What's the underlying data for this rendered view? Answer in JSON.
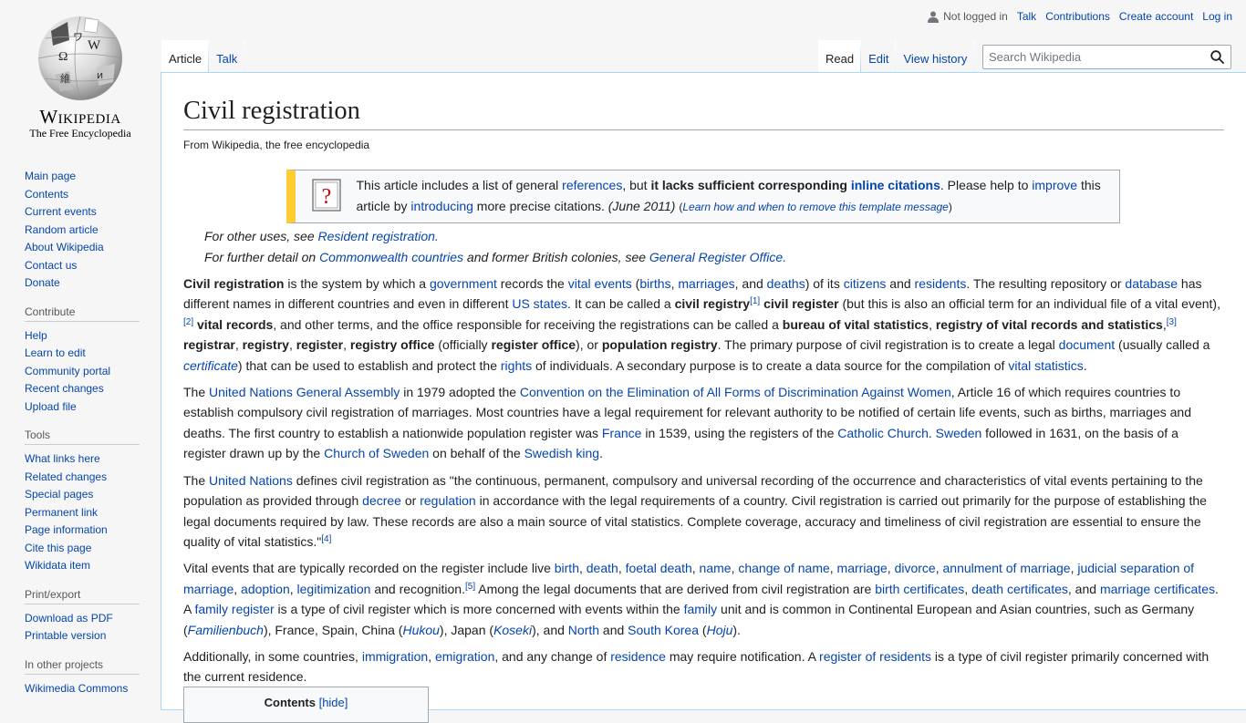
{
  "logo": {
    "wordmark": "Wikipedia",
    "tagline": "The Free Encyclopedia"
  },
  "sidebar": {
    "nav": [
      "Main page",
      "Contents",
      "Current events",
      "Random article",
      "About Wikipedia",
      "Contact us",
      "Donate"
    ],
    "contribute": {
      "heading": "Contribute",
      "items": [
        "Help",
        "Learn to edit",
        "Community portal",
        "Recent changes",
        "Upload file"
      ]
    },
    "tools": {
      "heading": "Tools",
      "items": [
        "What links here",
        "Related changes",
        "Special pages",
        "Permanent link",
        "Page information",
        "Cite this page",
        "Wikidata item"
      ]
    },
    "print": {
      "heading": "Print/export",
      "items": [
        "Download as PDF",
        "Printable version"
      ]
    },
    "projects": {
      "heading": "In other projects",
      "items": [
        "Wikimedia Commons"
      ]
    }
  },
  "personal": {
    "not_logged": "Not logged in",
    "talk": "Talk",
    "contributions": "Contributions",
    "create_account": "Create account",
    "login": "Log in"
  },
  "tabs": {
    "article": "Article",
    "talk": "Talk",
    "read": "Read",
    "edit": "Edit",
    "history": "View history"
  },
  "search": {
    "placeholder": "Search Wikipedia"
  },
  "page": {
    "title": "Civil registration",
    "sitesub": "From Wikipedia, the free encyclopedia",
    "ambox": {
      "t1": "This article includes a list of general ",
      "l1": "references",
      "t2": ", but ",
      "b1": "it lacks sufficient corresponding ",
      "l2": "inline citations",
      "t3": ". Please help to ",
      "l3": "improve",
      "t4": " this article by ",
      "l4": "introducing",
      "t5": " more precise citations. ",
      "date": "(June 2011)",
      "l5": "Learn how and when to remove this template message"
    },
    "hat1": {
      "text": "For other uses, see ",
      "link": "Resident registration."
    },
    "hat2": {
      "text": "For further detail on ",
      "link1": "Commonwealth countries",
      "mid": " and former British colonies, see ",
      "link2": "General Register Office."
    },
    "p1": [
      [
        "b",
        "Civil registration"
      ],
      [
        "t",
        " is the system by which a "
      ],
      [
        "a",
        "government"
      ],
      [
        "t",
        " records the "
      ],
      [
        "a",
        "vital events"
      ],
      [
        "t",
        " ("
      ],
      [
        "a",
        "births"
      ],
      [
        "t",
        ", "
      ],
      [
        "a",
        "marriages"
      ],
      [
        "t",
        ", and "
      ],
      [
        "a",
        "deaths"
      ],
      [
        "t",
        ") of its "
      ],
      [
        "a",
        "citizens"
      ],
      [
        "t",
        " and "
      ],
      [
        "a",
        "residents"
      ],
      [
        "t",
        ". The resulting repository or "
      ],
      [
        "a",
        "database"
      ],
      [
        "t",
        " has different names in different countries and even in different "
      ],
      [
        "a",
        "US states"
      ],
      [
        "t",
        ". It can be called a "
      ],
      [
        "b",
        "civil registry"
      ],
      [
        "s",
        "[1]"
      ],
      [
        "t",
        " "
      ],
      [
        "b",
        "civil register"
      ],
      [
        "t",
        " (but this is also an official term for an individual file of a vital event),"
      ],
      [
        "s",
        "[2]"
      ],
      [
        "t",
        " "
      ],
      [
        "b",
        "vital records"
      ],
      [
        "t",
        ", and other terms, and the office responsible for receiving the registrations can be called a "
      ],
      [
        "b",
        "bureau of vital statistics"
      ],
      [
        "t",
        ", "
      ],
      [
        "b",
        "registry of vital records and statistics"
      ],
      [
        "t",
        ","
      ],
      [
        "s",
        "[3]"
      ],
      [
        "t",
        " "
      ],
      [
        "b",
        "registrar"
      ],
      [
        "t",
        ", "
      ],
      [
        "b",
        "registry"
      ],
      [
        "t",
        ", "
      ],
      [
        "b",
        "register"
      ],
      [
        "t",
        ", "
      ],
      [
        "b",
        "registry office"
      ],
      [
        "t",
        " (officially "
      ],
      [
        "b",
        "register office"
      ],
      [
        "t",
        "), or "
      ],
      [
        "b",
        "population registry"
      ],
      [
        "t",
        ". The primary purpose of civil registration is to create a legal "
      ],
      [
        "a",
        "document"
      ],
      [
        "t",
        " (usually called a "
      ],
      [
        "ai",
        "certificate"
      ],
      [
        "t",
        ") that can be used to establish and protect the "
      ],
      [
        "a",
        "rights"
      ],
      [
        "t",
        " of individuals. A secondary purpose is to create a data source for the compilation of "
      ],
      [
        "a",
        "vital statistics"
      ],
      [
        "t",
        "."
      ]
    ],
    "p2": [
      [
        "t",
        "The "
      ],
      [
        "a",
        "United Nations General Assembly"
      ],
      [
        "t",
        " in 1979 adopted the "
      ],
      [
        "a",
        "Convention on the Elimination of All Forms of Discrimination Against Women"
      ],
      [
        "t",
        ", Article 16 of which requires countries to establish compulsory civil registration of marriages. Most countries have a legal requirement for relevant authority to be notified of certain life events, such as births, marriages and deaths. The first country to establish a nationwide population register was "
      ],
      [
        "a",
        "France"
      ],
      [
        "t",
        " in 1539, using the registers of the "
      ],
      [
        "a",
        "Catholic Church"
      ],
      [
        "t",
        ". "
      ],
      [
        "a",
        "Sweden"
      ],
      [
        "t",
        " followed in 1631, on the basis of a register drawn up by the "
      ],
      [
        "a",
        "Church of Sweden"
      ],
      [
        "t",
        " on behalf of the "
      ],
      [
        "a",
        "Swedish king"
      ],
      [
        "t",
        "."
      ]
    ],
    "p3": [
      [
        "t",
        "The "
      ],
      [
        "a",
        "United Nations"
      ],
      [
        "t",
        " defines civil registration as \"the continuous, permanent, compulsory and universal recording of the occurrence and characteristics of vital events pertaining to the population as provided through "
      ],
      [
        "a",
        "decree"
      ],
      [
        "t",
        " or "
      ],
      [
        "a",
        "regulation"
      ],
      [
        "t",
        " in accordance with the legal requirements of a country. Civil registration is carried out primarily for the purpose of establishing the legal documents required by law. These records are also a main source of vital statistics. Complete coverage, accuracy and timeliness of civil registration are essential to ensure the quality of vital statistics.\""
      ],
      [
        "s",
        "[4]"
      ]
    ],
    "p4": [
      [
        "t",
        "Vital events that are typically recorded on the register include live "
      ],
      [
        "a",
        "birth"
      ],
      [
        "t",
        ", "
      ],
      [
        "a",
        "death"
      ],
      [
        "t",
        ", "
      ],
      [
        "a",
        "foetal death"
      ],
      [
        "t",
        ", "
      ],
      [
        "a",
        "name"
      ],
      [
        "t",
        ", "
      ],
      [
        "a",
        "change of name"
      ],
      [
        "t",
        ", "
      ],
      [
        "a",
        "marriage"
      ],
      [
        "t",
        ", "
      ],
      [
        "a",
        "divorce"
      ],
      [
        "t",
        ", "
      ],
      [
        "a",
        "annulment of marriage"
      ],
      [
        "t",
        ", "
      ],
      [
        "a",
        "judicial separation of marriage"
      ],
      [
        "t",
        ", "
      ],
      [
        "a",
        "adoption"
      ],
      [
        "t",
        ", "
      ],
      [
        "a",
        "legitimization"
      ],
      [
        "t",
        " and recognition."
      ],
      [
        "s",
        "[5]"
      ],
      [
        "t",
        " Among the legal documents that are derived from civil registration are "
      ],
      [
        "a",
        "birth certificates"
      ],
      [
        "t",
        ", "
      ],
      [
        "a",
        "death certificates"
      ],
      [
        "t",
        ", and "
      ],
      [
        "a",
        "marriage certificates"
      ],
      [
        "t",
        ". A "
      ],
      [
        "a",
        "family register"
      ],
      [
        "t",
        " is a type of civil register which is more concerned with events within the "
      ],
      [
        "a",
        "family"
      ],
      [
        "t",
        " unit and is common in Continental European and Asian countries, such as Germany ("
      ],
      [
        "ai",
        "Familienbuch"
      ],
      [
        "t",
        "), France, Spain, China ("
      ],
      [
        "ai",
        "Hukou"
      ],
      [
        "t",
        "), Japan ("
      ],
      [
        "ai",
        "Koseki"
      ],
      [
        "t",
        "), and "
      ],
      [
        "a",
        "North"
      ],
      [
        "t",
        " and "
      ],
      [
        "a",
        "South Korea"
      ],
      [
        "t",
        " ("
      ],
      [
        "ai",
        "Hoju"
      ],
      [
        "t",
        ")."
      ]
    ],
    "p5": [
      [
        "t",
        "Additionally, in some countries, "
      ],
      [
        "a",
        "immigration"
      ],
      [
        "t",
        ", "
      ],
      [
        "a",
        "emigration"
      ],
      [
        "t",
        ", and any change of "
      ],
      [
        "a",
        "residence"
      ],
      [
        "t",
        " may require notification. A "
      ],
      [
        "a",
        "register of residents"
      ],
      [
        "t",
        " is a type of civil register primarily concerned with the current residence."
      ]
    ],
    "toc": {
      "label": "Contents",
      "toggle": "[hide]"
    }
  }
}
